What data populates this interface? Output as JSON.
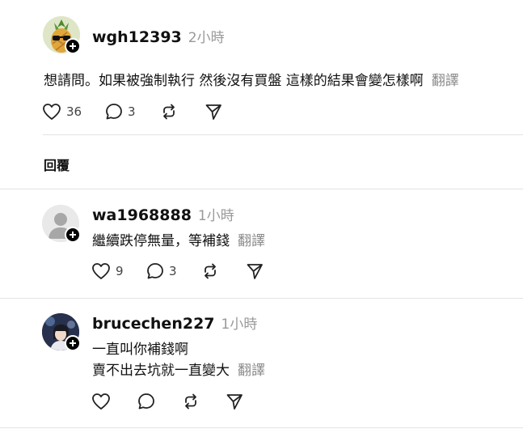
{
  "post": {
    "username": "wgh12393",
    "time": "2小時",
    "text": "想請問。如果被強制執行 然後沒有買盤 這樣的結果會變怎樣啊",
    "translate": "翻譯",
    "likes": "36",
    "replies": "3"
  },
  "section_label": "回覆",
  "comments": [
    {
      "username": "wa1968888",
      "time": "1小時",
      "lines": [
        "繼續跌停無量，等補錢"
      ],
      "translate": "翻譯",
      "likes": "9",
      "replies": "3"
    },
    {
      "username": "brucechen227",
      "time": "1小時",
      "lines": [
        "一直叫你補錢啊",
        "賣不出去坑就一直變大"
      ],
      "translate": "翻譯",
      "likes": "",
      "replies": ""
    }
  ],
  "icons": {
    "like": "heart-icon",
    "reply": "comment-icon",
    "repost": "repost-icon",
    "share": "send-icon",
    "follow": "plus-icon"
  },
  "colors": {
    "muted": "#999999",
    "divider": "#e3e3e3",
    "text": "#111111"
  }
}
